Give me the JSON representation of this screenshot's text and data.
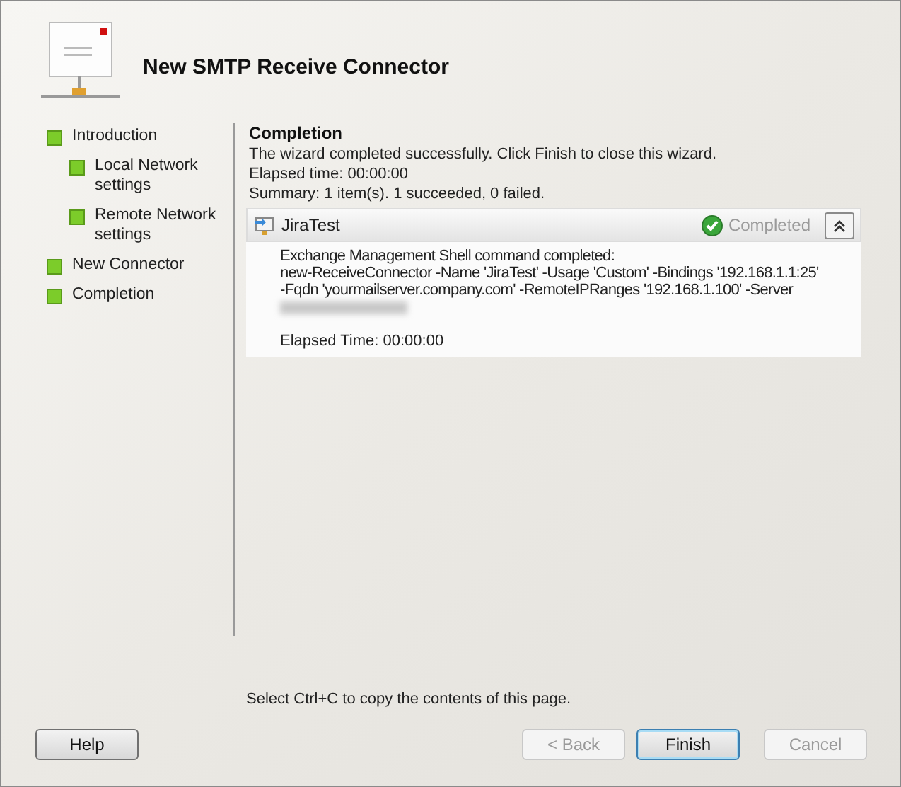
{
  "window": {
    "title": "New SMTP Receive Connector"
  },
  "steps": [
    {
      "label": "Introduction",
      "done": true,
      "children": [
        {
          "label": "Local Network settings",
          "done": true
        },
        {
          "label": "Remote Network settings",
          "done": true
        }
      ]
    },
    {
      "label": "New Connector",
      "done": true
    },
    {
      "label": "Completion",
      "done": true
    }
  ],
  "page": {
    "heading": "Completion",
    "lines": [
      "The wizard completed successfully. Click Finish to close this wizard.",
      "Elapsed time: 00:00:00",
      "Summary: 1 item(s). 1 succeeded, 0 failed."
    ]
  },
  "task": {
    "name": "JiraTest",
    "status": "Completed",
    "expanded": true,
    "output": [
      "Exchange Management Shell command completed:",
      "new-ReceiveConnector -Name 'JiraTest' -Usage 'Custom' -Bindings '192.168.1.1:25'",
      "-Fqdn 'yourmailserver.company.com' -RemoteIPRanges '192.168.1.100' -Server"
    ],
    "redacted": true,
    "elapsed": "Elapsed Time: 00:00:00"
  },
  "hint": "Select Ctrl+C to copy the contents of this page.",
  "buttons": [
    {
      "label": "Help",
      "disabled": false,
      "default": false,
      "kind": "left"
    },
    {
      "label": "< Back",
      "disabled": true,
      "kind": "right"
    },
    {
      "label": "Finish",
      "disabled": false,
      "default": true,
      "kind": "right"
    },
    {
      "label": "Cancel",
      "disabled": true,
      "kind": "right"
    }
  ]
}
